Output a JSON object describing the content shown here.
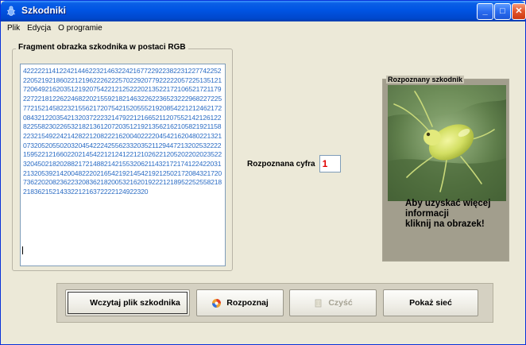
{
  "window": {
    "title": "Szkodniki",
    "controls": {
      "minimize": "_",
      "maximize": "□",
      "close": "✕"
    }
  },
  "menu": [
    "Plik",
    "Edycja",
    "O programie"
  ],
  "rgb_fragment": {
    "title": "Fragment obrazka szkodnika w postaci RGB",
    "content": "4222221141224214462232146322421677229223822312277422522205219218602212196222622257022920779222220572251351217206492162035121920754221212522202135221721065217211792272218122622468220215592182146322622365232229682272257721521458223215562172075421520555219208542212124621720843212203542132037222321479221216652112075521421261228225582302265321821361207203512192135621621058219211582232154922421428221208222162004022220454216204802213210732052055020320454222425562332035211294472132025322221595221216602202145422121241221210262212052022020235223204502182028821721488214215532062114321721741224220312132053921420048222021654219214542192125021720843217207362202082362232083621820053216201922212189522525582182183621521433221216372222124922320",
    "caret": "|"
  },
  "recognized_digit": {
    "label": "Rozpoznana cyfra",
    "value": "1"
  },
  "recognized_pest": {
    "title": "Rozpoznany szkodnik",
    "caption_lines": [
      "Aby uzyskać więcej",
      "informacji",
      "kliknij na obrazek!"
    ]
  },
  "buttons": {
    "load": "Wczytaj plik szkodnika",
    "recognize": "Rozpoznaj",
    "clear": "Czyść",
    "show_network": "Pokaż sieć"
  },
  "colors": {
    "titlebar": "#0054e3",
    "window_bg": "#ece9d8",
    "rgb_text": "#2b6cc4",
    "digit_value": "#e00000",
    "pest_panel": "#a29e8d"
  },
  "icons": {
    "app": "bug-icon",
    "recognize": "recognize-orb-icon",
    "clear": "eraser-icon",
    "load": "file-icon"
  }
}
